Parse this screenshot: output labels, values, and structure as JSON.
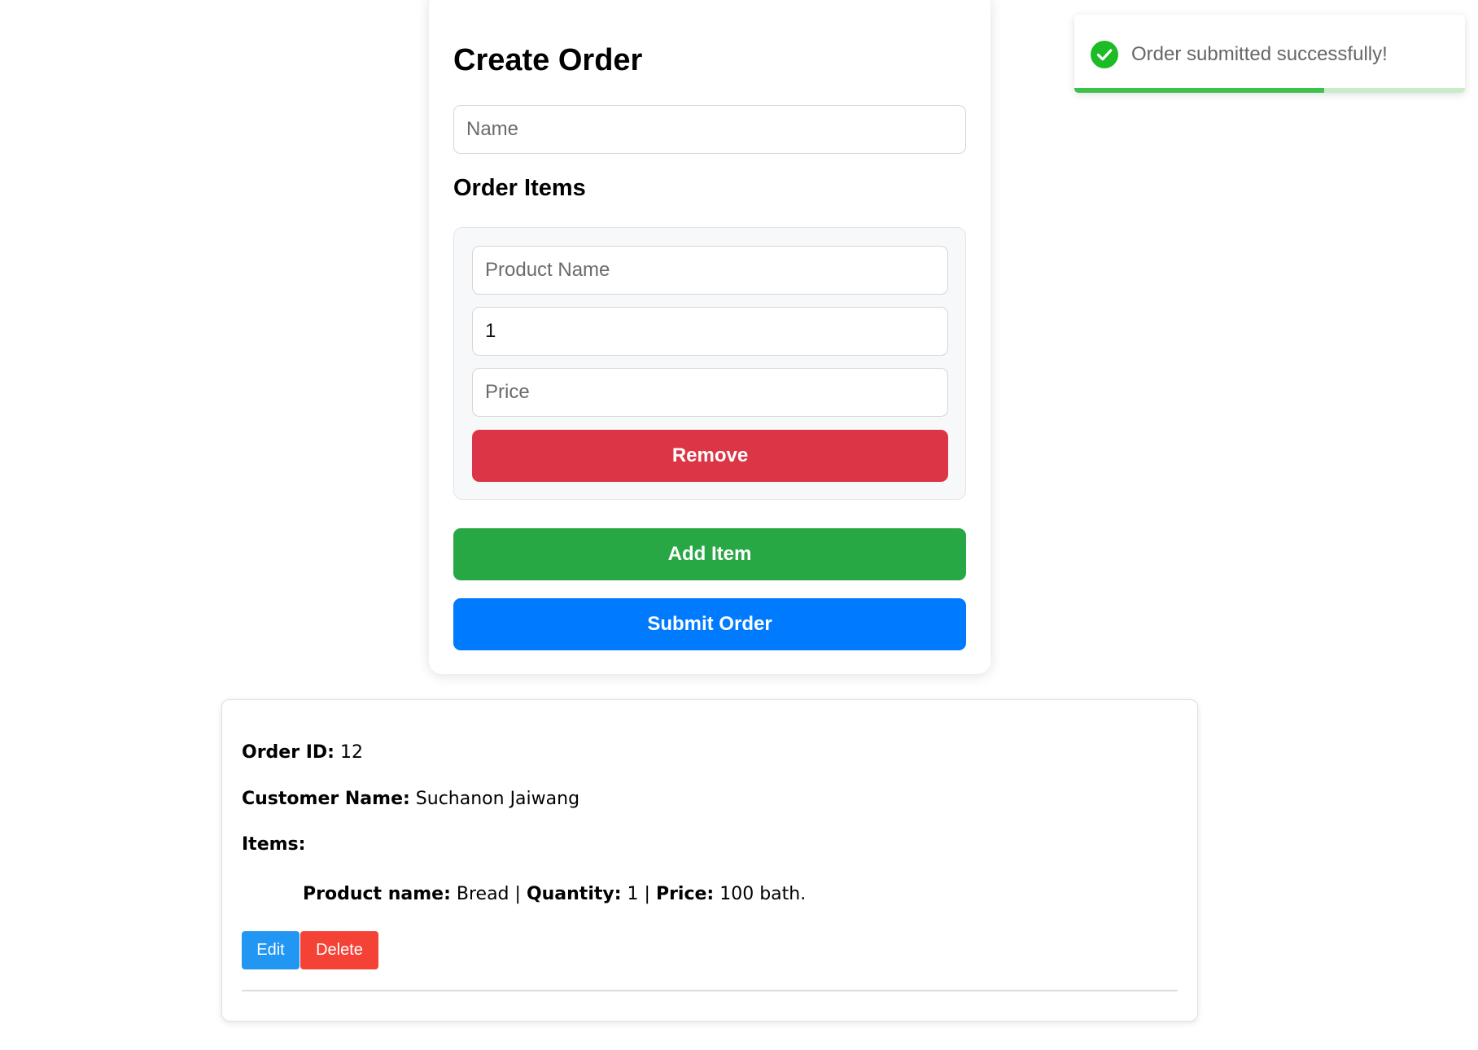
{
  "create_order": {
    "title": "Create Order",
    "name_placeholder": "Name",
    "name_value": "",
    "items_heading": "Order Items",
    "item": {
      "product_placeholder": "Product Name",
      "product_value": "",
      "quantity_value": "1",
      "price_placeholder": "Price",
      "price_value": "",
      "remove_label": "Remove"
    },
    "add_item_label": "Add Item",
    "submit_label": "Submit Order"
  },
  "order": {
    "id_label": "Order ID:",
    "id_value": "12",
    "customer_label": "Customer Name:",
    "customer_value": "Suchanon Jaiwang",
    "items_label": "Items:",
    "product_label": "Product name:",
    "product_value": "Bread",
    "separator": "|",
    "quantity_label": "Quantity:",
    "quantity_value": "1",
    "price_label": "Price:",
    "price_value": "100 bath.",
    "edit_label": "Edit",
    "delete_label": "Delete"
  },
  "toast": {
    "message": "Order submitted successfully!",
    "icon": "check-circle-icon",
    "progress_percent": 64
  },
  "colors": {
    "remove": "#dc3545",
    "add": "#28a745",
    "submit": "#007bff",
    "edit": "#2196f3",
    "delete": "#f44336",
    "toast_success": "#3cc24a"
  }
}
